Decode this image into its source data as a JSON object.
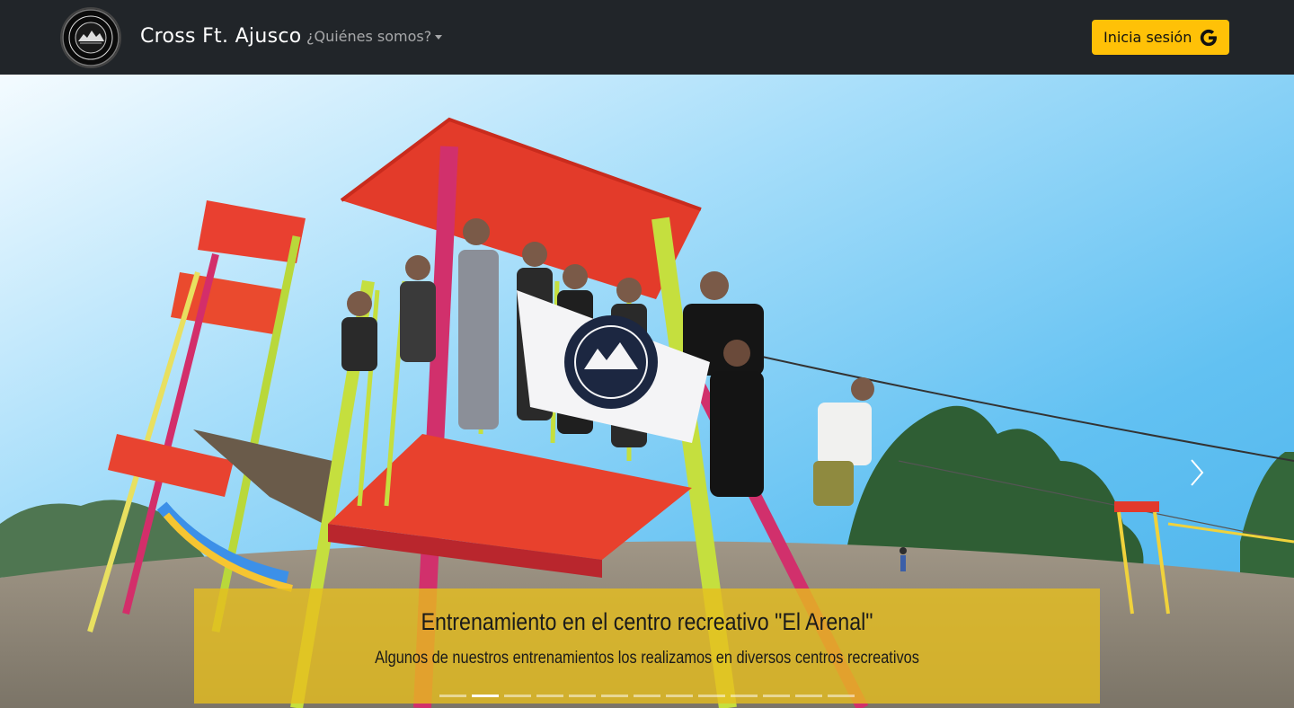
{
  "navbar": {
    "brand": "Cross Ft. Ajusco",
    "about_menu": "¿Quiénes somos?",
    "login_button": "Inicia sesión",
    "login_icon": "google-icon",
    "logo_icon": "cross-ft-ajusco-logo",
    "background": "#212529",
    "accent": "#ffc107"
  },
  "carousel": {
    "caption_title": "Entrenamiento en el centro recreativo \"El Arenal\"",
    "caption_text": "Algunos de nuestros entrenamientos los realizamos en diversos centros recreativos",
    "slide_count": 13,
    "active_slide": 2,
    "next_icon": "chevron-right-icon",
    "caption_color": "#e6be1e"
  }
}
